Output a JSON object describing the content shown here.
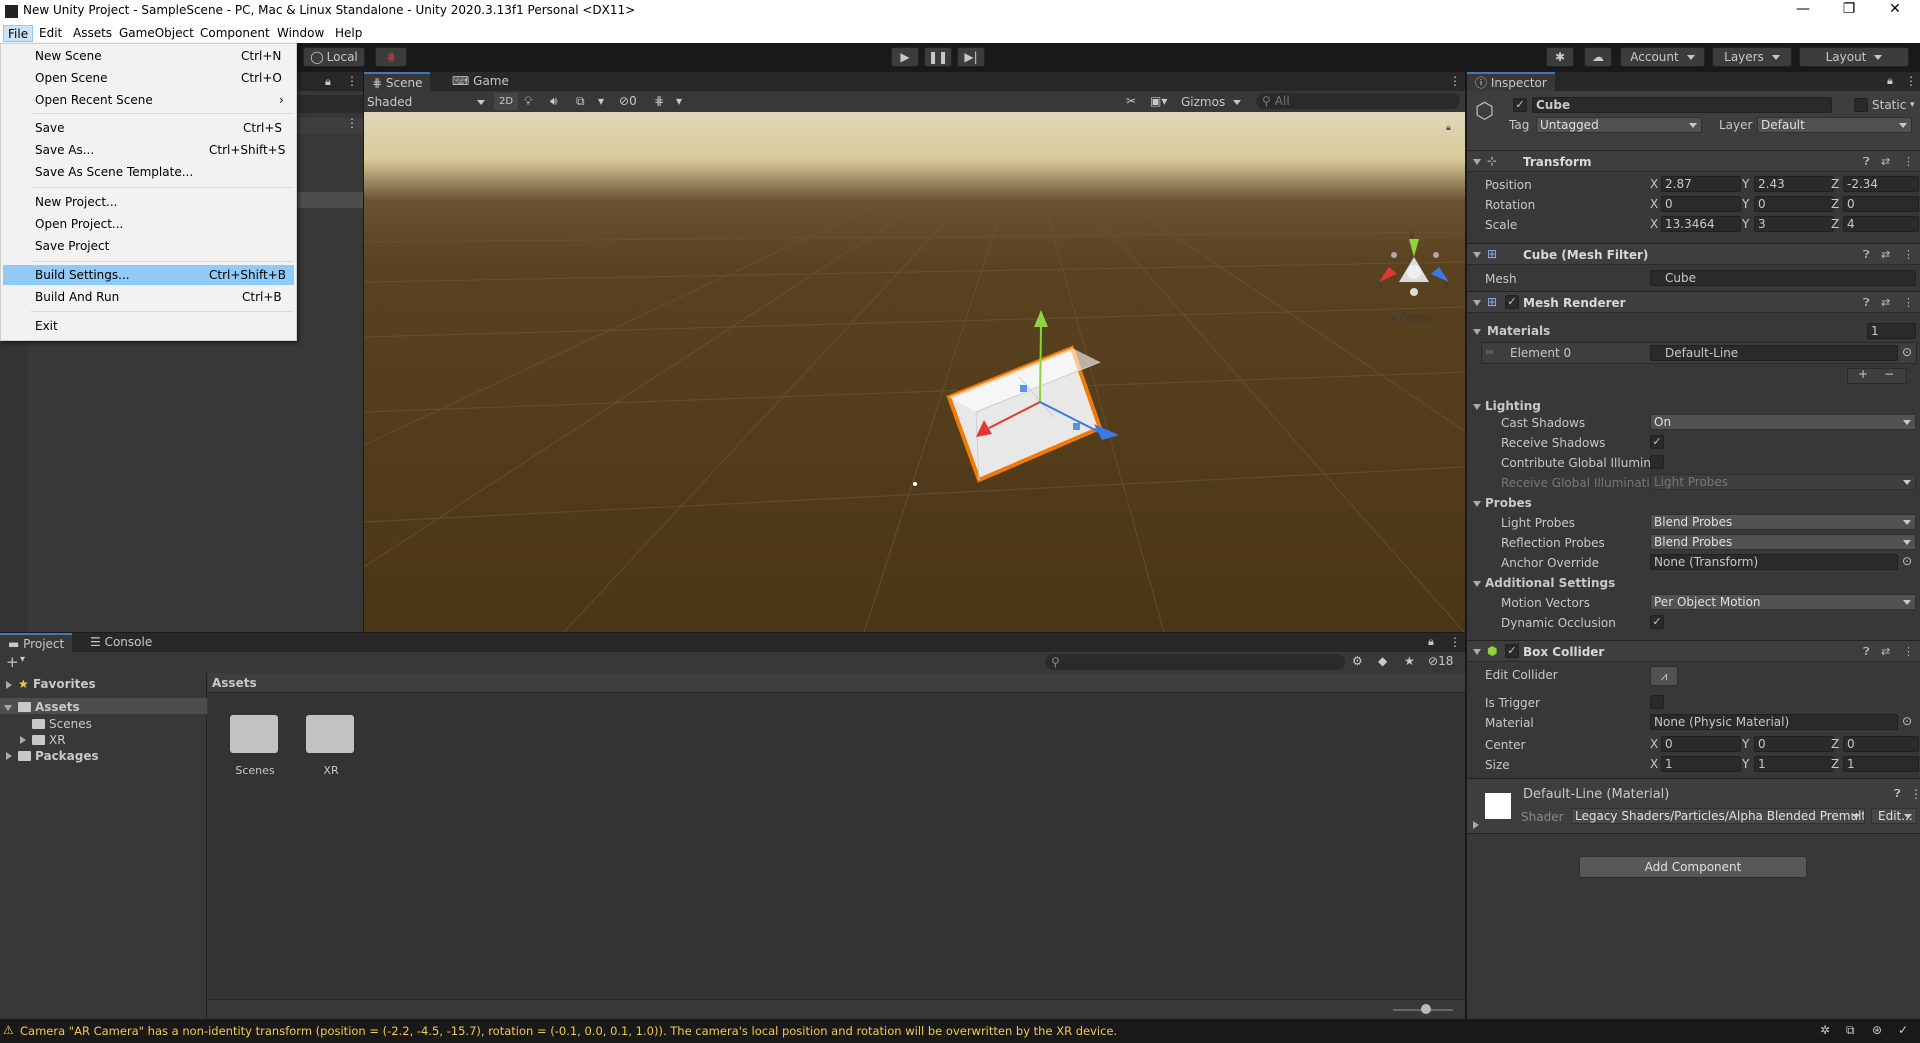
{
  "window": {
    "title": "New Unity Project - SampleScene - PC, Mac & Linux Standalone - Unity 2020.3.13f1 Personal <DX11>",
    "minimize": "—",
    "maximize": "❐",
    "close": "✕"
  },
  "menubar": {
    "items": [
      "File",
      "Edit",
      "Assets",
      "GameObject",
      "Component",
      "Window",
      "Help"
    ]
  },
  "toolbar": {
    "pivot_local": "Local",
    "account": "Account",
    "layers": "Layers",
    "layout": "Layout"
  },
  "file_menu": {
    "new_scene": {
      "label": "New Scene",
      "shortcut": "Ctrl+N"
    },
    "open_scene": {
      "label": "Open Scene",
      "shortcut": "Ctrl+O"
    },
    "open_recent": {
      "label": "Open Recent Scene",
      "shortcut": "›"
    },
    "save": {
      "label": "Save",
      "shortcut": "Ctrl+S"
    },
    "save_as": {
      "label": "Save As...",
      "shortcut": "Ctrl+Shift+S"
    },
    "save_template": {
      "label": "Save As Scene Template...",
      "shortcut": ""
    },
    "new_project": {
      "label": "New Project...",
      "shortcut": ""
    },
    "open_project": {
      "label": "Open Project...",
      "shortcut": ""
    },
    "save_project": {
      "label": "Save Project",
      "shortcut": ""
    },
    "build_settings": {
      "label": "Build Settings...",
      "shortcut": "Ctrl+Shift+B"
    },
    "build_and_run": {
      "label": "Build And Run",
      "shortcut": "Ctrl+B"
    },
    "exit": {
      "label": "Exit",
      "shortcut": ""
    }
  },
  "scene": {
    "tab_scene": "Scene",
    "tab_game": "Game",
    "shading": "Shaded",
    "mode_2d": "2D",
    "hidden_count": "0",
    "gizmos": "Gizmos",
    "search_placeholder": "All",
    "persp": "<Persp",
    "axis_y": "y",
    "axis_x": "x",
    "axis_z": "z"
  },
  "project": {
    "tab_project": "Project",
    "tab_console": "Console",
    "add": "+",
    "favorites": "Favorites",
    "assets": "Assets",
    "scenes": "Scenes",
    "xr": "XR",
    "packages": "Packages",
    "breadcrumb": "Assets",
    "hidden_count": "18",
    "grid_items": [
      "Scenes",
      "XR"
    ]
  },
  "inspector": {
    "tab": "Inspector",
    "object_name": "Cube",
    "static": "Static",
    "tag_label": "Tag",
    "tag": "Untagged",
    "layer_label": "Layer",
    "layer": "Default",
    "transform": {
      "title": "Transform",
      "position_label": "Position",
      "rotation_label": "Rotation",
      "scale_label": "Scale",
      "position": {
        "x": "2.87",
        "y": "2.43",
        "z": "-2.34"
      },
      "rotation": {
        "x": "0",
        "y": "0",
        "z": "0"
      },
      "scale": {
        "x": "13.3464",
        "y": "3",
        "z": "4"
      }
    },
    "mesh_filter": {
      "title": "Cube (Mesh Filter)",
      "mesh_label": "Mesh",
      "mesh": "Cube"
    },
    "mesh_renderer": {
      "title": "Mesh Renderer",
      "materials_label": "Materials",
      "materials_count": "1",
      "element0_label": "Element 0",
      "element0": "Default-Line",
      "lighting": "Lighting",
      "cast_shadows_label": "Cast Shadows",
      "cast_shadows": "On",
      "receive_shadows_label": "Receive Shadows",
      "contribute_gi_label": "Contribute Global Illuminat",
      "receive_gi_label": "Receive Global Illuminatio",
      "receive_gi": "Light Probes",
      "probes": "Probes",
      "light_probes_label": "Light Probes",
      "light_probes": "Blend Probes",
      "reflection_probes_label": "Reflection Probes",
      "reflection_probes": "Blend Probes",
      "anchor_override_label": "Anchor Override",
      "anchor_override": "None (Transform)",
      "additional": "Additional Settings",
      "motion_vectors_label": "Motion Vectors",
      "motion_vectors": "Per Object Motion",
      "dynamic_occlusion_label": "Dynamic Occlusion"
    },
    "box_collider": {
      "title": "Box Collider",
      "edit_collider_label": "Edit Collider",
      "is_trigger_label": "Is Trigger",
      "material_label": "Material",
      "material": "None (Physic Material)",
      "center_label": "Center",
      "size_label": "Size",
      "center": {
        "x": "0",
        "y": "0",
        "z": "0"
      },
      "size": {
        "x": "1",
        "y": "1",
        "z": "1"
      }
    },
    "material": {
      "name": "Default-Line (Material)",
      "shader_label": "Shader",
      "shader": "Legacy Shaders/Particles/Alpha Blended Premulti",
      "edit": "Edit..."
    },
    "add_component": "Add Component"
  },
  "status": {
    "message": "Camera \"AR Camera\" has a non-identity transform (position = (-2.2, -4.5, -15.7), rotation = (-0.1, 0.0, 0.1, 1.0)). The camera's local position and rotation will be overwritten by the XR device."
  },
  "colors": {
    "accent": "#3a79bb",
    "menu_highlight": "#91c9f7",
    "warning": "#f2c84b",
    "selection_orange": "#f27a00",
    "gizmo_x": "#e03a30",
    "gizmo_y": "#8dd33a",
    "gizmo_z": "#3a7ae6"
  },
  "icons": {
    "warning": "warning-icon",
    "play": "play-icon",
    "pause": "pause-icon",
    "step": "step-icon",
    "folder": "folder-icon",
    "star": "star-icon"
  }
}
